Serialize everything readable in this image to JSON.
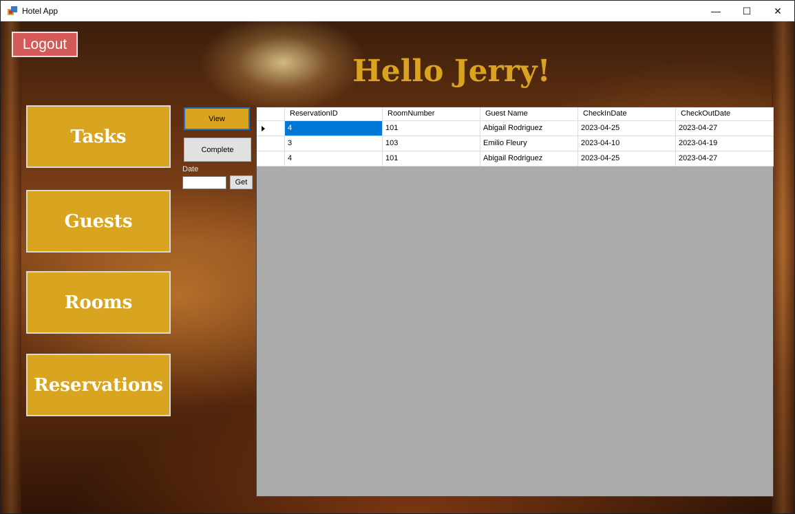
{
  "window": {
    "title": "Hotel App",
    "minimize_glyph": "—",
    "maximize_glyph": "☐",
    "close_glyph": "✕"
  },
  "header": {
    "logout_label": "Logout",
    "greeting": "Hello Jerry!"
  },
  "nav": {
    "items": [
      {
        "label": "Tasks"
      },
      {
        "label": "Guests"
      },
      {
        "label": "Rooms"
      },
      {
        "label": "Reservations"
      }
    ]
  },
  "actions": {
    "view_label": "View",
    "complete_label": "Complete",
    "date_label": "Date",
    "date_value": "",
    "get_label": "Get"
  },
  "grid": {
    "columns": [
      "ReservationID",
      "RoomNumber",
      "Guest Name",
      "CheckInDate",
      "CheckOutDate"
    ],
    "rows": [
      [
        "4",
        "101",
        "Abigail Rodriguez",
        "2023-04-25",
        "2023-04-27"
      ],
      [
        "3",
        "103",
        "Emilio Fleury",
        "2023-04-10",
        "2023-04-19"
      ],
      [
        "4",
        "101",
        "Abigail Rodriguez",
        "2023-04-25",
        "2023-04-27"
      ]
    ]
  },
  "colors": {
    "accent_gold": "#d9a521",
    "logout_red": "#d45a5a",
    "selection_blue": "#0078d7",
    "grid_background": "#ababab"
  }
}
